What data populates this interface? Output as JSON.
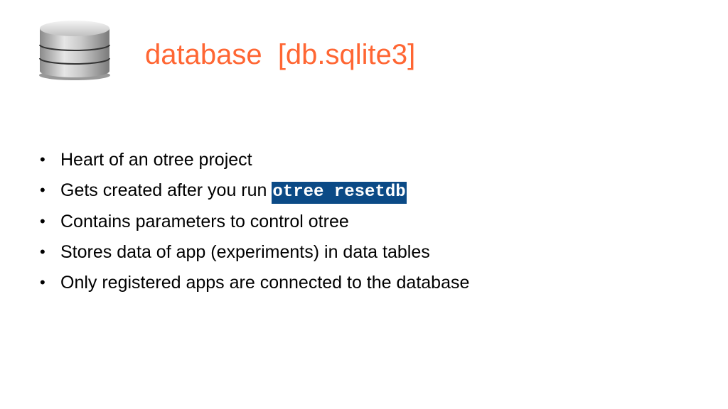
{
  "slide": {
    "title": "database  [db.sqlite3]",
    "icon": "database-icon",
    "colors": {
      "title": "#ff6633",
      "code_background": "#0b4a86",
      "code_text": "#ffffff"
    },
    "bullets": [
      {
        "text": "Heart of an otree project"
      },
      {
        "text": "Gets created after you run ",
        "code": "otree resetdb"
      },
      {
        "text": "Contains parameters to control otree"
      },
      {
        "text": "Stores data of app (experiments) in data tables"
      },
      {
        "text": "Only registered apps are connected to the database"
      }
    ]
  }
}
